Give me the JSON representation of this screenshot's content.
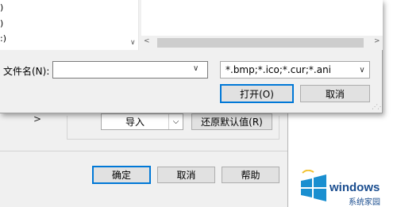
{
  "file_dialog": {
    "list_fragments": [
      ")",
      ")",
      ":)"
    ],
    "filename_label": "文件名(N):",
    "filename_value": "",
    "filter_value": "*.bmp;*.ico;*.cur;*.ani",
    "open_button": "打开(O)",
    "cancel_button": "取消"
  },
  "background_dialog": {
    "import_label": "导入",
    "restore_button": "还原默认值(R)",
    "ok_button": "确定",
    "cancel_button": "取消",
    "help_button": "帮助"
  },
  "watermark": {
    "brand": "windows",
    "site": "系统家园"
  },
  "icons": {
    "scroll_down": "chevron-down-icon",
    "scroll_left": "chevron-left-icon",
    "scroll_right": "chevron-right-icon",
    "dropdown": "chevron-down-icon",
    "expand": "chevron-right-icon",
    "logo": "windows-logo-icon"
  },
  "colors": {
    "accent": "#0078d7",
    "dialog_bg": "#f0f0f0",
    "button_bg": "#e1e1e1",
    "watermark": "#1a4d8f"
  }
}
